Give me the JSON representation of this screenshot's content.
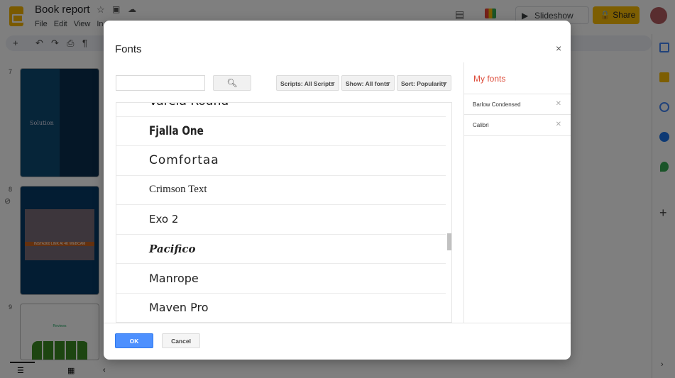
{
  "app": {
    "title": "Book report",
    "menus": [
      "File",
      "Edit",
      "View",
      "In"
    ],
    "slideshow_label": "Slideshow",
    "share_label": "Share"
  },
  "filmstrip": {
    "slides": [
      {
        "number": "7",
        "title": "Solution"
      },
      {
        "number": "8",
        "caption": "INSTA360 LINK AI 4K WEBCAM"
      },
      {
        "number": "9",
        "title": "Reviews"
      }
    ]
  },
  "dialog": {
    "title": "Fonts",
    "close_label": "×",
    "search": {
      "value": "",
      "placeholder": ""
    },
    "filters": {
      "scripts": "Scripts: All Scripts",
      "show": "Show: All fonts",
      "sort": "Sort: Popularity"
    },
    "fonts": [
      "Varela Round",
      "Fjalla One",
      "Comfortaa",
      "Crimson Text",
      "Exo 2",
      "Pacifico",
      "Manrope",
      "Maven Pro"
    ],
    "my_fonts": {
      "title": "My fonts",
      "items": [
        "Barlow Condensed",
        "Calibri"
      ]
    },
    "ok_label": "OK",
    "cancel_label": "Cancel"
  },
  "colors": {
    "accent": "#4d90fe",
    "my_fonts_title": "#dd4b39",
    "share": "#fbbc04"
  }
}
